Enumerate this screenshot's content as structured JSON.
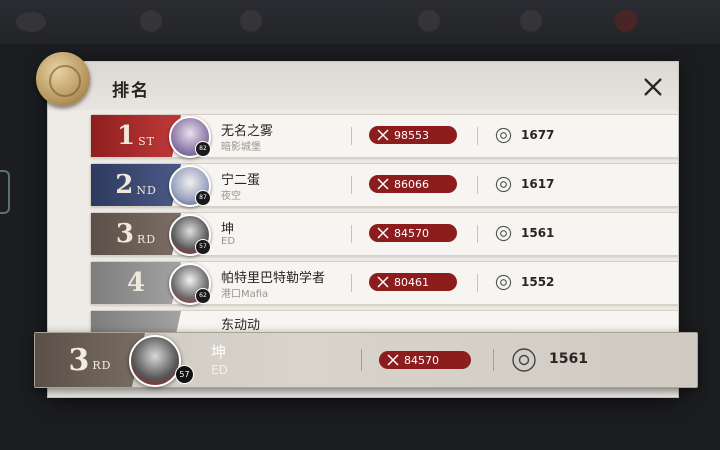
{
  "panel": {
    "title": "排名"
  },
  "icons": {
    "close": "close-icon",
    "power": "crossed-swords-icon",
    "score": "compass-badge-icon",
    "seal": "wax-seal-icon"
  },
  "colors": {
    "rank1": "#b32c2c",
    "rank2": "#3c4b72",
    "rank3": "#6d5f57",
    "rank4": "#8d8d8d",
    "power_pill": "#8d1d1d"
  },
  "rows": [
    {
      "rank": "1",
      "suffix": "ST",
      "name": "无名之雾",
      "guild": "暗影城堡",
      "level": "82",
      "power": "98553",
      "score": "1677"
    },
    {
      "rank": "2",
      "suffix": "ND",
      "name": "宁二蛋",
      "guild": "夜空",
      "level": "87",
      "power": "86066",
      "score": "1617"
    },
    {
      "rank": "3",
      "suffix": "RD",
      "name": "坤",
      "guild": "ED",
      "level": "57",
      "power": "84570",
      "score": "1561"
    },
    {
      "rank": "4",
      "suffix": "",
      "name": "帕特里巴特勒学者",
      "guild": "港口Mafia",
      "level": "62",
      "power": "80461",
      "score": "1552"
    }
  ],
  "partial_row_name": "东动动",
  "self": {
    "rank": "3",
    "suffix": "RD",
    "name": "坤",
    "guild": "ED",
    "level": "57",
    "power": "84570",
    "score": "1561"
  }
}
